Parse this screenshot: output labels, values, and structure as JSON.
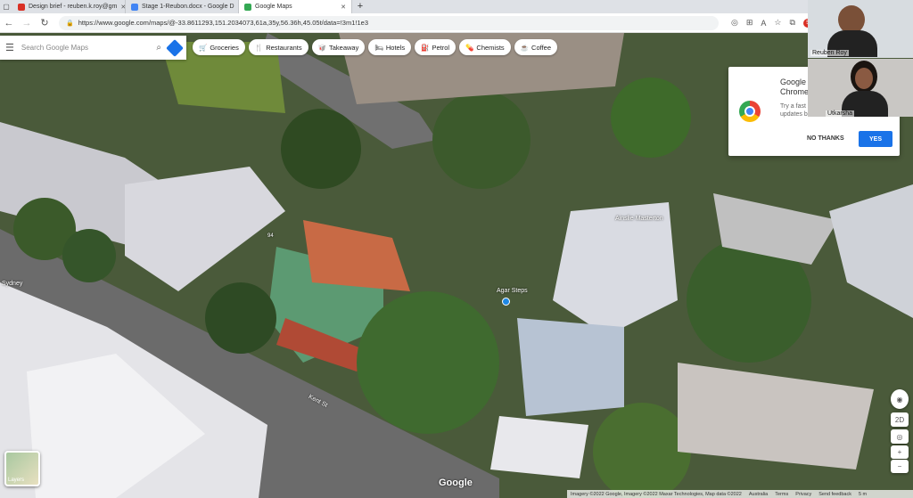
{
  "tabs": [
    {
      "label": "Design brief - reuben.k.roy@gm",
      "color": "#d93025"
    },
    {
      "label": "Stage 1-Reubon.docx - Google D",
      "color": "#4285f4"
    },
    {
      "label": "Google Maps",
      "color": "#34a853",
      "active": true
    }
  ],
  "browser": {
    "url": "https://www.google.com/maps/@-33.8611293,151.2034073,61a,35y,56.36h,45.05t/data=!3m1!1e3",
    "badge": "5"
  },
  "search": {
    "placeholder": "Search Google Maps"
  },
  "chips": [
    {
      "label": "Groceries",
      "icon": "cart-icon"
    },
    {
      "label": "Restaurants",
      "icon": "fork-icon"
    },
    {
      "label": "Takeaway",
      "icon": "takeaway-icon"
    },
    {
      "label": "Hotels",
      "icon": "bed-icon"
    },
    {
      "label": "Petrol",
      "icon": "fuel-icon"
    },
    {
      "label": "Chemists",
      "icon": "pill-icon"
    },
    {
      "label": "Coffee",
      "icon": "coffee-icon"
    }
  ],
  "map_labels": {
    "place1": "Agar Steps",
    "place2": "Ainslie Masterton",
    "place3": "Sydney",
    "street1": "Kent St",
    "num": "94"
  },
  "popup": {
    "title": "Google\nChrome",
    "body": "Try a fast\nupdates b",
    "no": "NO THANKS",
    "yes": "YES"
  },
  "participants": [
    {
      "name": "Reuben Roy"
    },
    {
      "name": "Utkarsha"
    }
  ],
  "controls": {
    "mode": "2D",
    "layers": "Layers"
  },
  "footer": [
    "Imagery ©2022 Google, Imagery ©2022 Maxar Technologies, Map data ©2022",
    "Australia",
    "Terms",
    "Privacy",
    "Send feedback",
    "5 m"
  ],
  "logo": "Google"
}
